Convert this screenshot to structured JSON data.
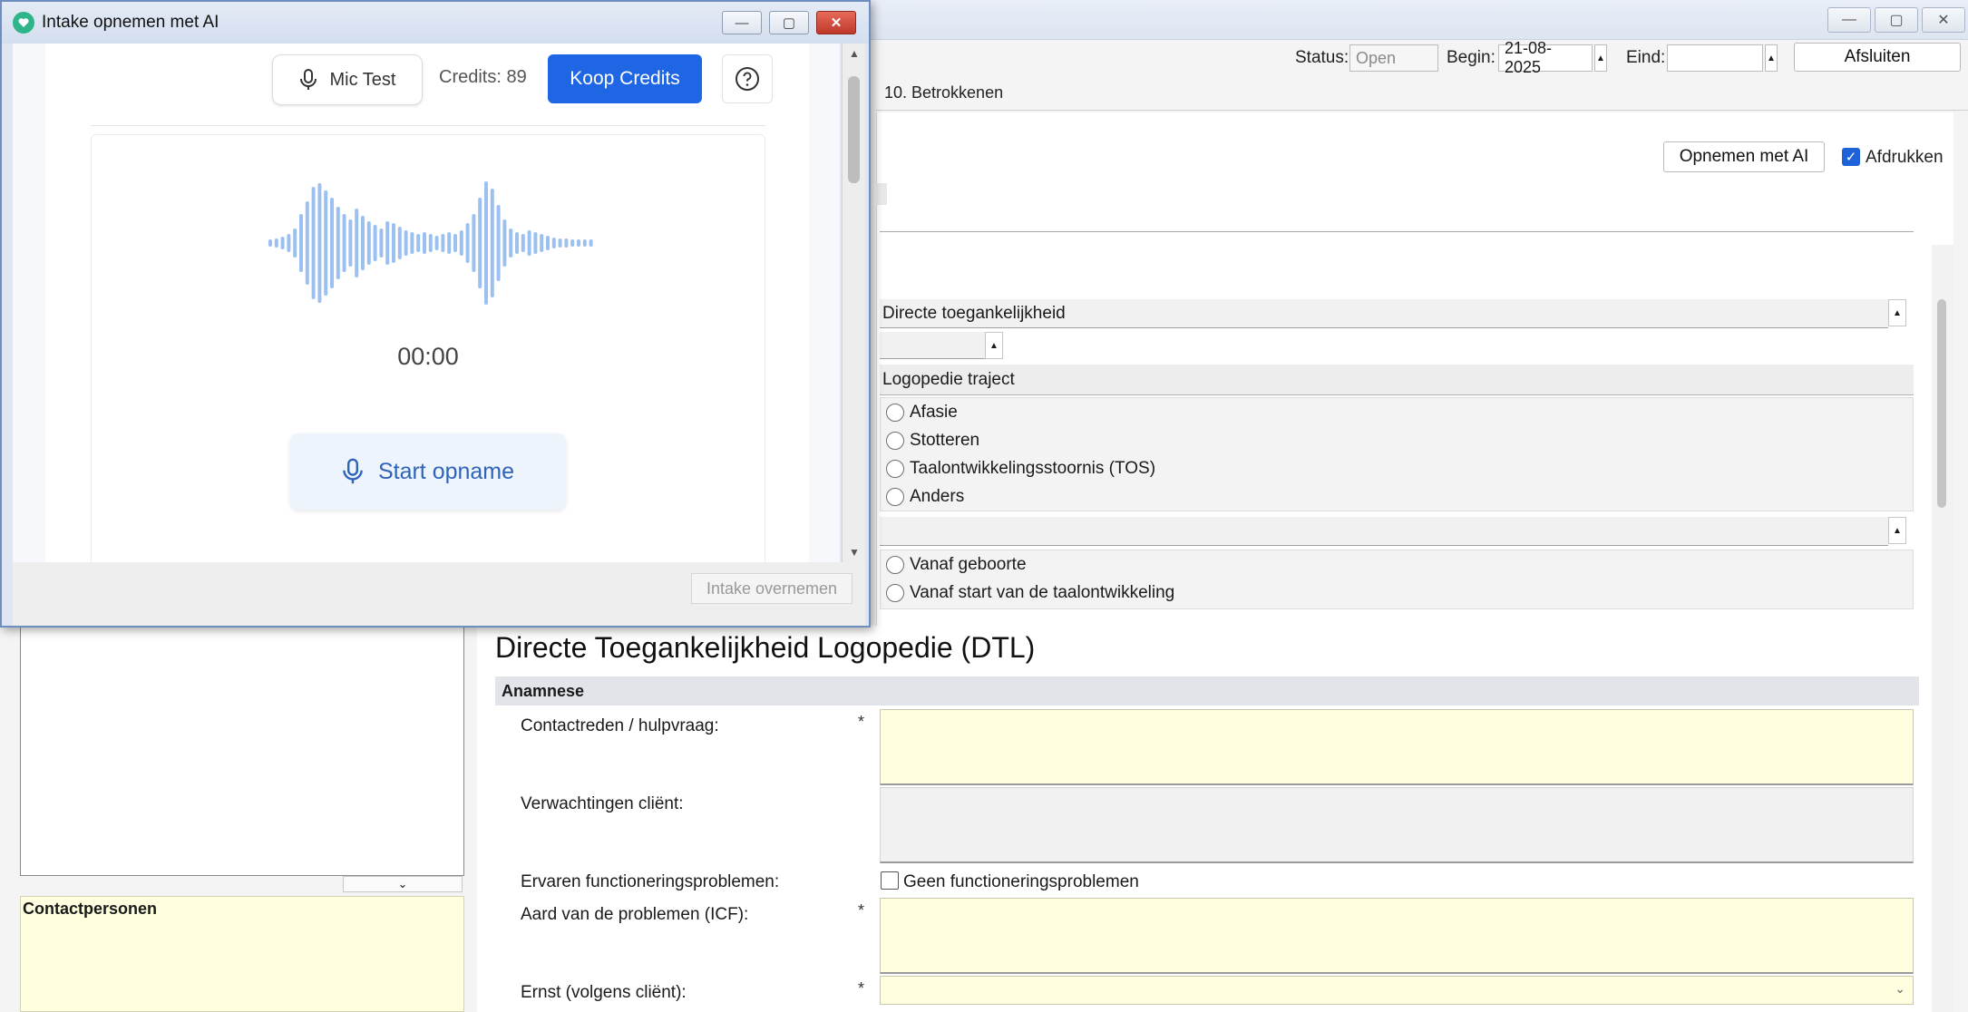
{
  "dialog": {
    "title": "Intake opnemen met AI",
    "mic_test_label": "Mic Test",
    "credits_text": "Credits: 89",
    "buy_credits_label": "Koop Credits",
    "timer": "00:00",
    "start_label": "Start opname",
    "footer_button": "Intake overnemen",
    "accent_color": "#1f66e5"
  },
  "main": {
    "status_label": "Status:",
    "status_value": "Open",
    "begin_label": "Begin:",
    "begin_value": "21-08-2025",
    "end_label": "Eind:",
    "end_value": "",
    "close_button": "Afsluiten",
    "tab_label": "10. Betrokkenen",
    "record_ai_button": "Opnemen met AI",
    "print_label": "Afdrukken",
    "print_checked": true,
    "dropdown1_value": "Directe toegankelijkheid",
    "section_traject": "Logopedie traject",
    "traject_options": [
      "Afasie",
      "Stotteren",
      "Taalontwikkelingsstoornis (TOS)",
      "Anders"
    ],
    "onset_options": [
      "Vanaf geboorte",
      "Vanaf start van de taalontwikkeling"
    ],
    "form_title": "Directe Toegankelijkheid Logopedie (DTL)",
    "section_anamnese": "Anamnese",
    "fields": {
      "contact_reason": "Contactreden / hulpvraag:",
      "expectations": "Verwachtingen cliënt:",
      "problems": "Ervaren functioneringsproblemen:",
      "no_problems": "Geen functioneringsproblemen",
      "nature": "Aard van de problemen (ICF):",
      "severity": "Ernst (volgens cliënt):",
      "required_mark": "*"
    },
    "contactpersons_title": "Contactpersonen"
  }
}
